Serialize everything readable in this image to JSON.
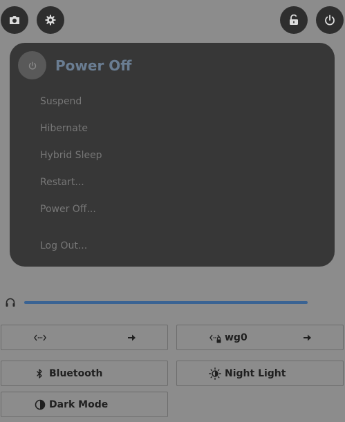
{
  "top_buttons": {
    "screenshot_icon": "camera-icon",
    "settings_icon": "gear-icon",
    "lock_icon": "lock-icon",
    "power_icon": "power-icon"
  },
  "power_menu": {
    "title": "Power Off",
    "items": [
      {
        "label": "Suspend"
      },
      {
        "label": "Hibernate"
      },
      {
        "label": "Hybrid Sleep"
      },
      {
        "label": "Restart..."
      },
      {
        "label": "Power Off..."
      },
      {
        "label": "Log Out..."
      }
    ]
  },
  "volume": {
    "icon": "headphones-icon",
    "level": 1.0
  },
  "tiles": {
    "network_1": {
      "label": "",
      "icon": "network-icon"
    },
    "network_2": {
      "label": "wg0",
      "icon": "vpn-icon"
    },
    "bluetooth": {
      "label": "Bluetooth",
      "icon": "bluetooth-icon"
    },
    "night_light": {
      "label": "Night Light",
      "icon": "sun-icon"
    },
    "dark_mode": {
      "label": "Dark Mode",
      "icon": "contrast-icon"
    }
  },
  "colors": {
    "background": "#8c8c8c",
    "panel": "#373737",
    "accent": "#3a6393",
    "title": "#6a7d92"
  }
}
